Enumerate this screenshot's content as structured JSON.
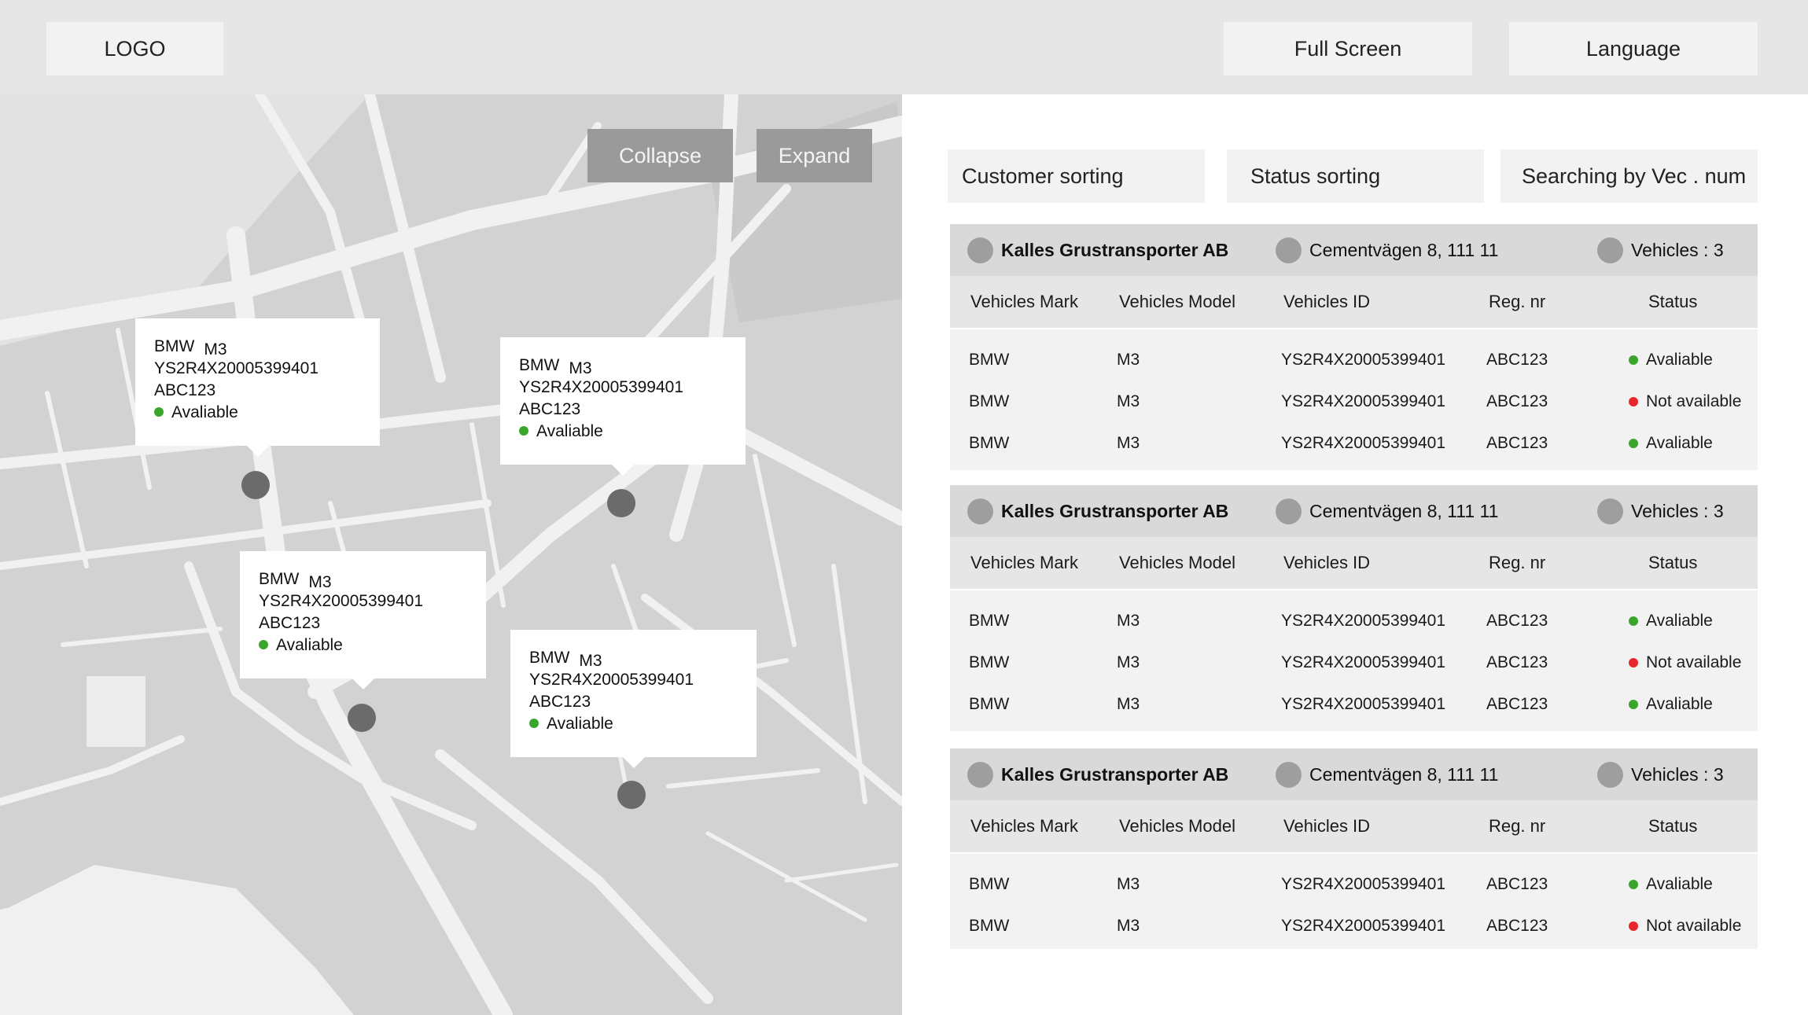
{
  "header": {
    "logo": "LOGO",
    "fullscreen_label": "Full Screen",
    "language_label": "Language"
  },
  "map": {
    "collapse_label": "Collapse",
    "expand_label": "Expand",
    "popups": [
      {
        "mark": "BMW",
        "model": "M3",
        "vehicle_id": "YS2R4X20005399401",
        "reg": "ABC123",
        "status": "Avaliable"
      },
      {
        "mark": "BMW",
        "model": "M3",
        "vehicle_id": "YS2R4X20005399401",
        "reg": "ABC123",
        "status": "Avaliable"
      },
      {
        "mark": "BMW",
        "model": "M3",
        "vehicle_id": "YS2R4X20005399401",
        "reg": "ABC123",
        "status": "Avaliable"
      },
      {
        "mark": "BMW",
        "model": "M3",
        "vehicle_id": "YS2R4X20005399401",
        "reg": "ABC123",
        "status": "Avaliable"
      }
    ]
  },
  "sorting": {
    "customer": "Customer sorting",
    "status": "Status sorting",
    "search": "Searching by Vec . num"
  },
  "table_columns": [
    "Vehicles Mark",
    "Vehicles Model",
    "Vehicles ID",
    "Reg. nr",
    "Status"
  ],
  "groups": [
    {
      "customer": "Kalles Grustransporter AB",
      "address": "Cementvägen 8, 111 11",
      "vehicles": "Vehicles : 3",
      "rows": [
        {
          "mark": "BMW",
          "model": "M3",
          "id": "YS2R4X20005399401",
          "reg": "ABC123",
          "status": "Avaliable",
          "status_color": "#3aa52b"
        },
        {
          "mark": "BMW",
          "model": "M3",
          "id": "YS2R4X20005399401",
          "reg": "ABC123",
          "status": "Not available",
          "status_color": "#e8262b"
        },
        {
          "mark": "BMW",
          "model": "M3",
          "id": "YS2R4X20005399401",
          "reg": "ABC123",
          "status": "Avaliable",
          "status_color": "#3aa52b"
        }
      ]
    },
    {
      "customer": "Kalles Grustransporter AB",
      "address": "Cementvägen 8, 111 11",
      "vehicles": "Vehicles : 3",
      "rows": [
        {
          "mark": "BMW",
          "model": "M3",
          "id": "YS2R4X20005399401",
          "reg": "ABC123",
          "status": "Avaliable",
          "status_color": "#3aa52b"
        },
        {
          "mark": "BMW",
          "model": "M3",
          "id": "YS2R4X20005399401",
          "reg": "ABC123",
          "status": "Not available",
          "status_color": "#e8262b"
        },
        {
          "mark": "BMW",
          "model": "M3",
          "id": "YS2R4X20005399401",
          "reg": "ABC123",
          "status": "Avaliable",
          "status_color": "#3aa52b"
        }
      ]
    },
    {
      "customer": "Kalles Grustransporter AB",
      "address": "Cementvägen 8, 111 11",
      "vehicles": "Vehicles : 3",
      "rows": [
        {
          "mark": "BMW",
          "model": "M3",
          "id": "YS2R4X20005399401",
          "reg": "ABC123",
          "status": "Avaliable",
          "status_color": "#3aa52b"
        },
        {
          "mark": "BMW",
          "model": "M3",
          "id": "YS2R4X20005399401",
          "reg": "ABC123",
          "status": "Not available",
          "status_color": "#e8262b"
        }
      ]
    }
  ],
  "colors": {
    "available": "#3aa52b",
    "not_available": "#e8262b",
    "header_bg": "#e6e6e6",
    "group_header_bg": "#d9d9d9"
  }
}
